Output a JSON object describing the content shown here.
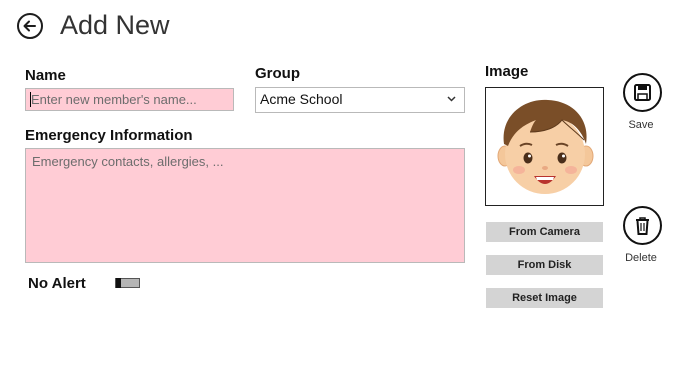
{
  "header": {
    "title": "Add New",
    "back_icon": "back-arrow-icon"
  },
  "form": {
    "name_label": "Name",
    "name_placeholder": "Enter new member's name...",
    "name_value": "",
    "group_label": "Group",
    "group_value": "Acme School",
    "emergency_label": "Emergency Information",
    "emergency_placeholder": "Emergency contacts, allergies, ...",
    "alert_label": "No Alert",
    "alert_on": false
  },
  "image_panel": {
    "label": "Image",
    "from_camera": "From Camera",
    "from_disk": "From Disk",
    "reset_image": "Reset Image"
  },
  "actions": {
    "save": "Save",
    "delete": "Delete"
  },
  "colors": {
    "required_field": "#ffccd5",
    "button_gray": "#d4d4d4"
  }
}
